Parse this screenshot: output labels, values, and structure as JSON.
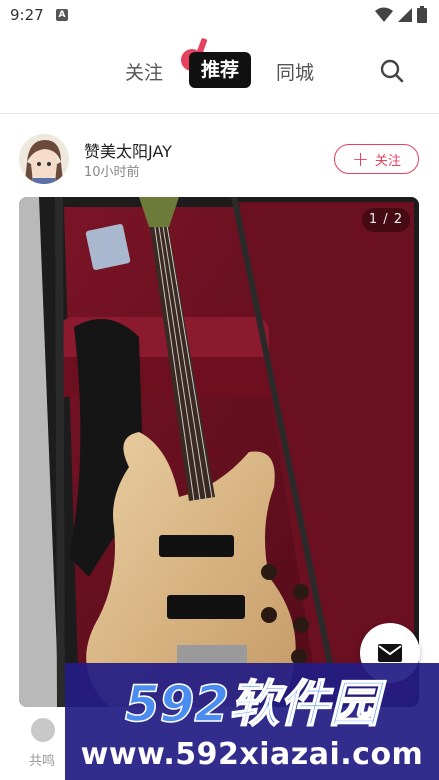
{
  "status_bar": {
    "time": "9:27",
    "notification_badge": "A",
    "icons": [
      "wifi-icon",
      "signal-icon",
      "battery-icon"
    ]
  },
  "top_nav": {
    "tabs": [
      {
        "label": "关注",
        "active": false
      },
      {
        "label": "推荐",
        "active": true
      },
      {
        "label": "同城",
        "active": false
      }
    ],
    "logo_icon": "music-note-icon",
    "search_icon": "search-icon"
  },
  "post": {
    "author_name": "赞美太阳JAY",
    "time_ago": "10小时前",
    "follow_label": "关注",
    "page_indicator": "1 / 2",
    "photo_subject": "bass guitar in red case"
  },
  "resonance": {
    "label": "共鸣"
  },
  "watermark": {
    "brand": "592软件园",
    "url": "www.592xiazai.com"
  },
  "colors": {
    "accent": "#e5405e",
    "nav_active_bg": "#111111",
    "watermark_bg": "#221c84",
    "watermark_text": "#4a8cf0"
  }
}
